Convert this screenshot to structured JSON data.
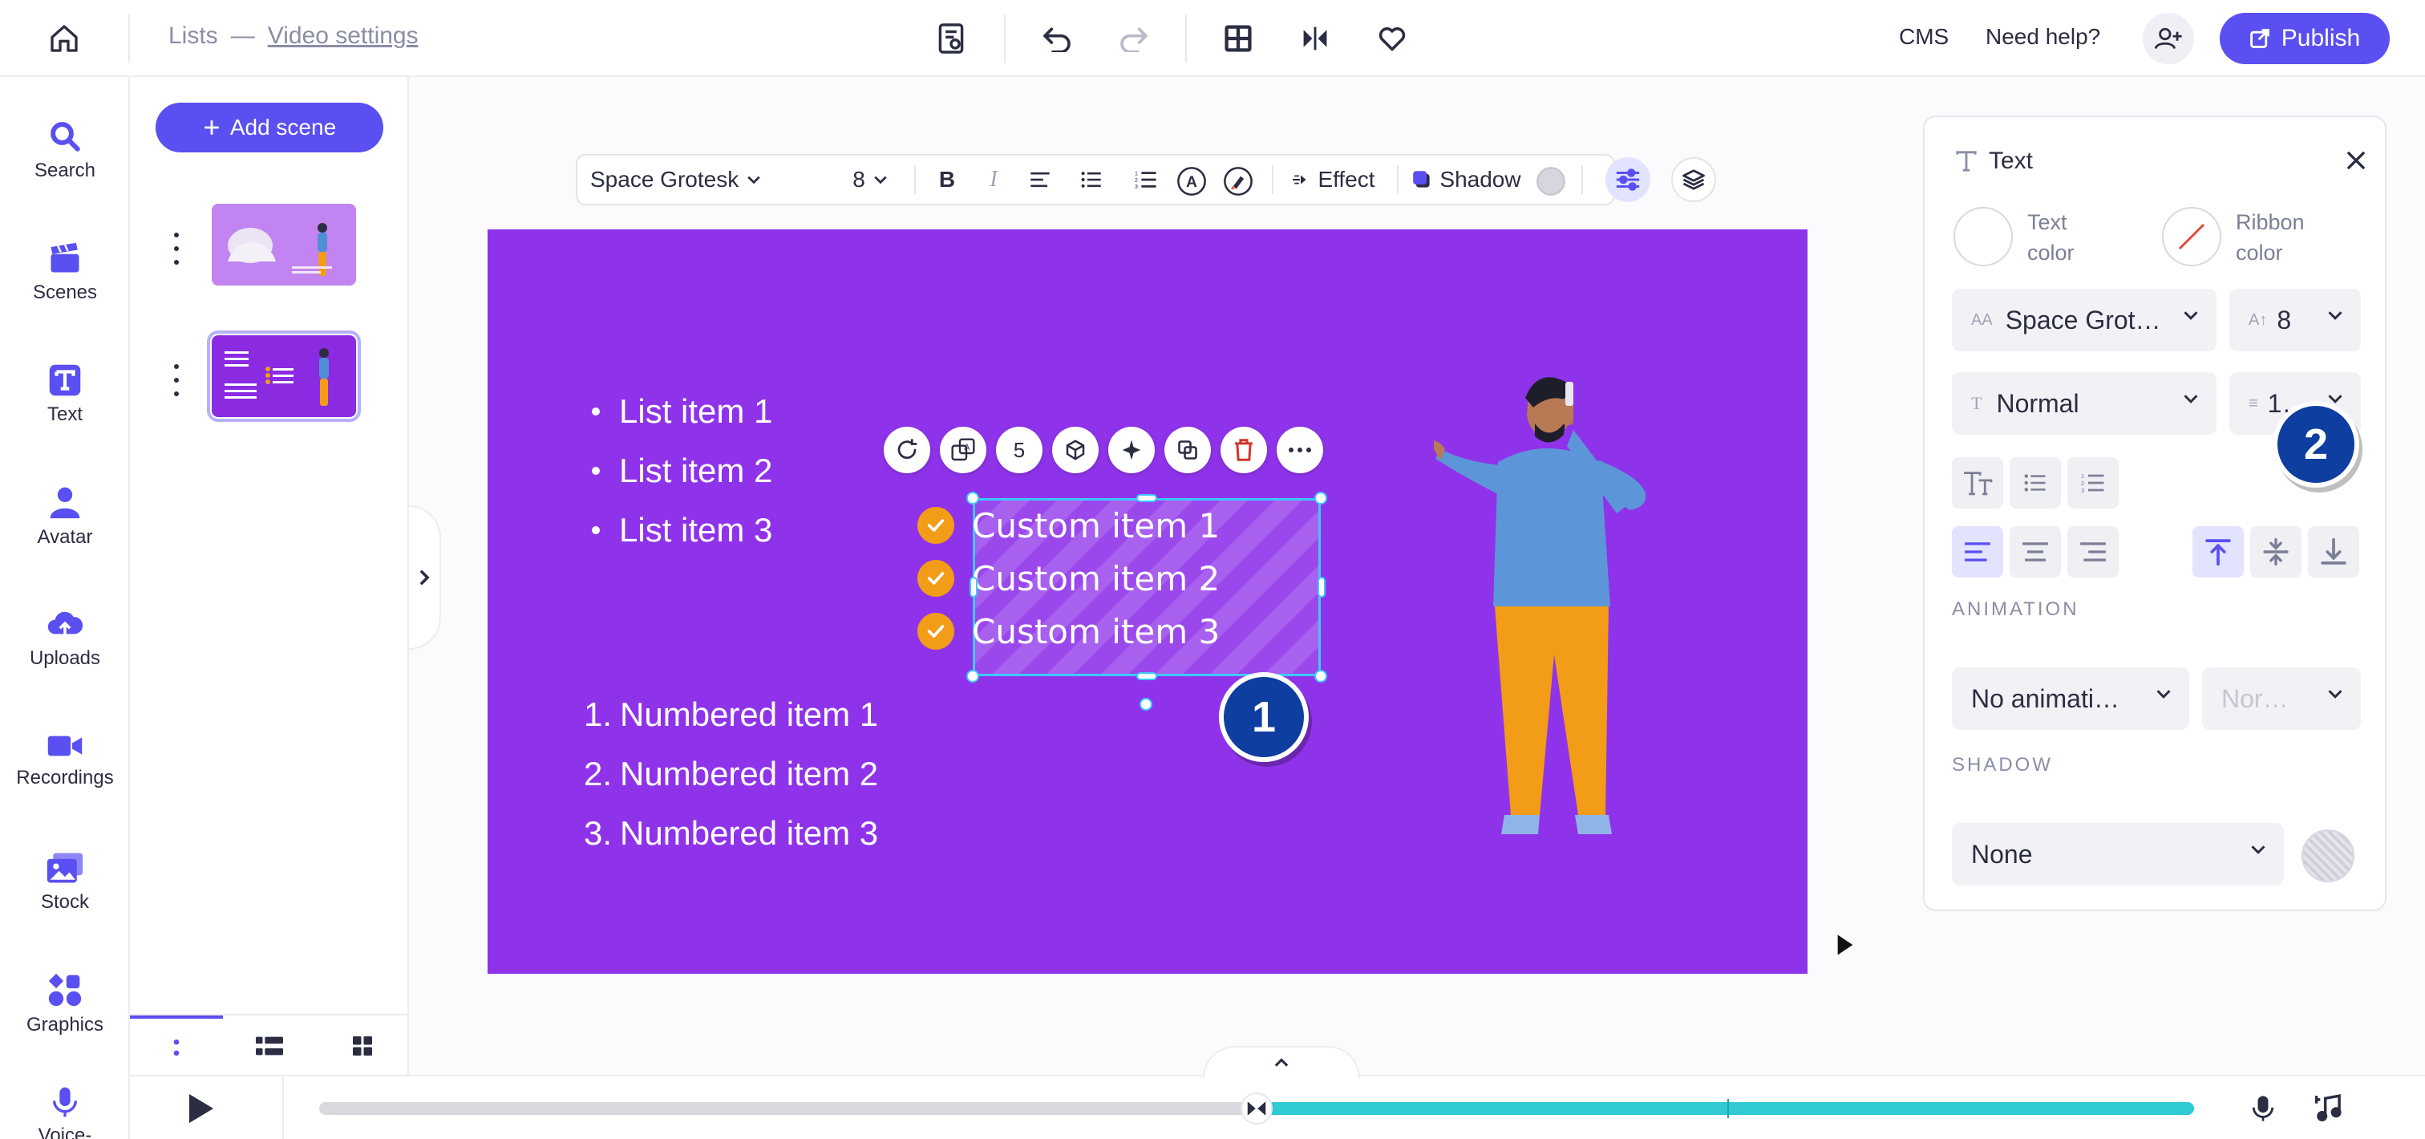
{
  "header": {
    "breadcrumb_root": "Lists",
    "breadcrumb_sep": "—",
    "breadcrumb_current": "Video settings",
    "cms_label": "CMS",
    "help_label": "Need help?",
    "publish_label": "Publish"
  },
  "rail": {
    "items": [
      {
        "label": "Search",
        "icon": "search-icon"
      },
      {
        "label": "Scenes",
        "icon": "clapperboard-icon"
      },
      {
        "label": "Text",
        "icon": "text-icon"
      },
      {
        "label": "Avatar",
        "icon": "avatar-icon"
      },
      {
        "label": "Uploads",
        "icon": "upload-cloud-icon"
      },
      {
        "label": "Recordings",
        "icon": "video-camera-icon"
      },
      {
        "label": "Stock",
        "icon": "image-stack-icon"
      },
      {
        "label": "Graphics",
        "icon": "shapes-icon"
      },
      {
        "label": "Voice-",
        "icon": "microphone-icon"
      }
    ]
  },
  "scenes": {
    "add_label": "Add scene"
  },
  "toolbar": {
    "font": "Space Grotesk",
    "size": "8",
    "effect_label": "Effect",
    "shadow_label": "Shadow"
  },
  "canvas": {
    "bullets": [
      "List item 1",
      "List item 2",
      "List item 3"
    ],
    "numbered": [
      {
        "n": "1.",
        "text": "Numbered item 1"
      },
      {
        "n": "2.",
        "text": "Numbered item 2"
      },
      {
        "n": "3.",
        "text": "Numbered item 3"
      }
    ],
    "custom": [
      "Custom item 1",
      "Custom item 2",
      "Custom item 3"
    ],
    "element_toolbar_count": "5",
    "badge_1": "1",
    "badge_2": "2",
    "background_color": "#8f33ea",
    "check_color": "#f39c18"
  },
  "props": {
    "title": "Text",
    "text_color_label": "Text color",
    "ribbon_color_label": "Ribbon color",
    "font": "Space Grot…",
    "size": "8",
    "weight": "Normal",
    "line_height": "1…",
    "animation_heading": "ANIMATION",
    "animation": "No animati…",
    "animation_speed": "Nor…",
    "shadow_heading": "SHADOW",
    "shadow": "None"
  },
  "timeline": {
    "progress_fraction": 0.5
  },
  "colors": {
    "accent": "#5a4ff0",
    "timeline_fill": "#2fcad2",
    "badge": "#0d3ea0"
  }
}
